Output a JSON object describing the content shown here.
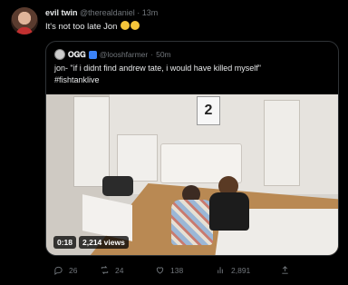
{
  "tweet": {
    "author_name": "evil twin",
    "author_handle": "@therealdaniel",
    "time": "13m",
    "text": "It's not too late Jon",
    "emojis": [
      "smiling-face",
      "smiling-face"
    ]
  },
  "quote": {
    "author_name": "𝐎𝐆𝐆",
    "author_handle": "@looshfarmer",
    "time": "50m",
    "text_line1": "jon- \"if i didnt find andrew tate, i would have killed myself\"",
    "text_line2": "#fishtanklive",
    "video": {
      "duration": "0:18",
      "views": "2,214 views",
      "poster_number": "2"
    }
  },
  "actions": {
    "replies": "26",
    "retweets": "24",
    "likes": "138",
    "views": "2,891",
    "icons": [
      "reply-icon",
      "retweet-icon",
      "like-icon",
      "views-icon",
      "share-icon"
    ]
  },
  "colors": {
    "background": "#000000",
    "text": "#e7e9ea",
    "muted": "#71767b",
    "border": "#2f3336"
  }
}
